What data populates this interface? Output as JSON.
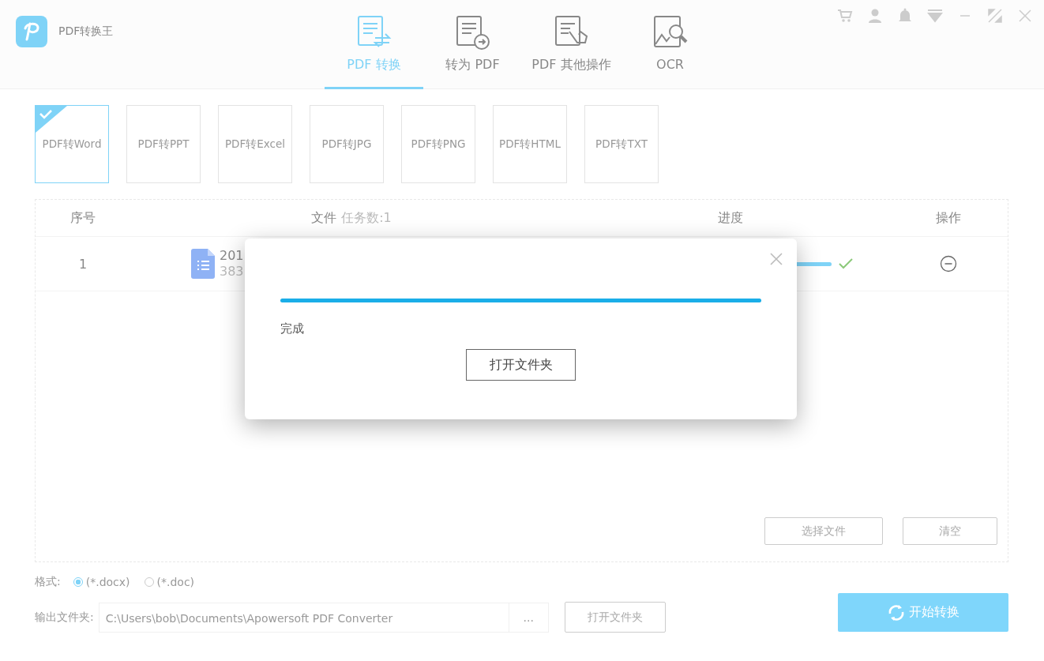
{
  "app": {
    "title": "PDF转换王"
  },
  "nav_tabs": [
    {
      "label": "PDF 转换",
      "selected": true
    },
    {
      "label": "转为 PDF",
      "selected": false
    },
    {
      "label": "PDF 其他操作",
      "selected": false
    },
    {
      "label": "OCR",
      "selected": false
    }
  ],
  "formats": [
    {
      "label": "PDF转Word",
      "selected": true
    },
    {
      "label": "PDF转PPT",
      "selected": false
    },
    {
      "label": "PDF转Excel",
      "selected": false
    },
    {
      "label": "PDF转JPG",
      "selected": false
    },
    {
      "label": "PDF转PNG",
      "selected": false
    },
    {
      "label": "PDF转HTML",
      "selected": false
    },
    {
      "label": "PDF转TXT",
      "selected": false
    }
  ],
  "table": {
    "columns": [
      "序号",
      "文件",
      "进度",
      "操作"
    ],
    "task_count": "任务数:1",
    "rows": [
      {
        "index": "1",
        "name": "201",
        "size": "383",
        "level": 1,
        "done": true
      }
    ]
  },
  "actions": [
    "选择文件",
    "清空"
  ],
  "format_options": {
    "label": "格式:",
    "options": [
      {
        "label": "(*.docx)",
        "selected": true
      },
      {
        "label": "(*.doc)",
        "selected": false
      }
    ]
  },
  "output": {
    "label": "输出文件夹:",
    "path": "C:\\Users\\bob\\Documents\\Apowersoft PDF Converter",
    "browse": "...",
    "open_folder": "打开文件夹"
  },
  "start_button": "开始转换",
  "dialog": {
    "level": 1,
    "status": "完成",
    "button": "打开文件夹"
  }
}
